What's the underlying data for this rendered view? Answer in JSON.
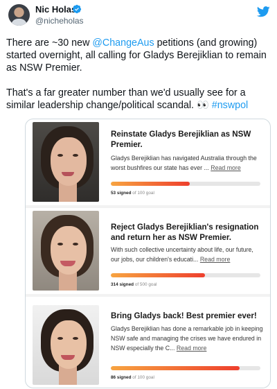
{
  "tweet": {
    "author_name": "Nic Holas",
    "author_handle": "@nicheholas",
    "body_prefix": "There are ~30 new ",
    "mention": "@ChangeAus",
    "body_mid": " petitions (and growing) started overnight, all calling for Gladys Berejiklian to remain as NSW Premier.",
    "body_line2": "That's a far greater number than we'd usually see for a similar leadership change/political scandal. ",
    "emoji": "👀",
    "hashtag": "#nswpol"
  },
  "petitions": [
    {
      "title": "Reinstate Gladys Berejiklian as NSW Premier.",
      "description": "Gladys Berejiklian has navigated Australia through the worst bushfires our state has ever ... ",
      "read_more": "Read more",
      "signed_count": "53 signed",
      "goal": "of 100 goal",
      "progress": 0.53
    },
    {
      "title": "Reject Gladys Berejiklian's resignation and return her as NSW Premier.",
      "description": "With such collective uncertainty about life, our future, our jobs, our children's educati... ",
      "read_more": "Read more",
      "signed_count": "314 signed",
      "goal": "of 500 goal",
      "progress": 0.63
    },
    {
      "title": "Bring Gladys back! Best premier ever!",
      "description": "Gladys Berejiklian has done a remarkable job in keeping NSW safe and managing the crises we have endured in NSW especially the C... ",
      "read_more": "Read more",
      "signed_count": "86 signed",
      "goal": "of 100 goal",
      "progress": 0.86
    }
  ],
  "colors": {
    "link": "#1d9bf0",
    "twitter_blue": "#1d9bf0",
    "verified_blue": "#1d9bf0",
    "progress_start": "#f7a441",
    "progress_end": "#ee3f2d"
  },
  "icons": [
    "verified-icon",
    "twitter-icon"
  ]
}
